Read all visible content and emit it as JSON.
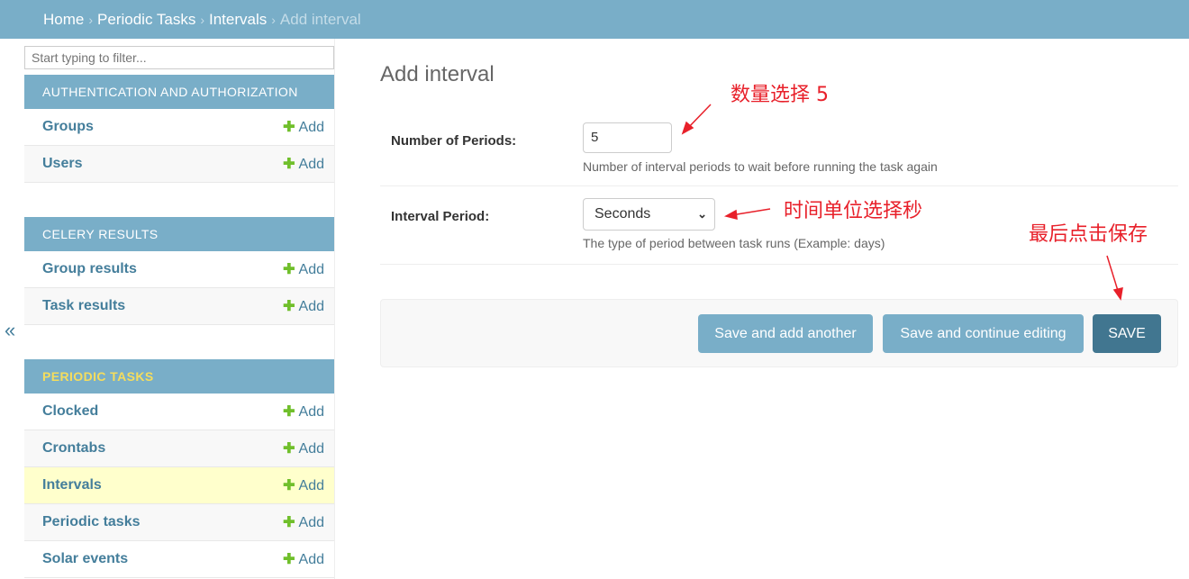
{
  "breadcrumb": {
    "items": [
      "Home",
      "Periodic Tasks",
      "Intervals"
    ],
    "current": "Add interval",
    "separator": "›"
  },
  "sidebar": {
    "filter_placeholder": "Start typing to filter...",
    "collapse": "«",
    "add_label": "Add",
    "sections": [
      {
        "title": "AUTHENTICATION AND AUTHORIZATION",
        "items": [
          "Groups",
          "Users"
        ]
      },
      {
        "title": "CELERY RESULTS",
        "items": [
          "Group results",
          "Task results"
        ]
      },
      {
        "title": "PERIODIC TASKS",
        "items": [
          "Clocked",
          "Crontabs",
          "Intervals",
          "Periodic tasks",
          "Solar events"
        ]
      }
    ],
    "selected": "Intervals"
  },
  "main": {
    "title": "Add interval",
    "fields": [
      {
        "label": "Number of Periods:",
        "value": "5",
        "help": "Number of interval periods to wait before running the task again"
      },
      {
        "label": "Interval Period:",
        "value": "Seconds",
        "help": "The type of period between task runs (Example: days)"
      }
    ],
    "buttons": {
      "save_add": "Save and add another",
      "save_continue": "Save and continue editing",
      "save": "SAVE"
    }
  },
  "annotations": [
    "数量选择 5",
    "时间单位选择秒",
    "最后点击保存"
  ],
  "colors": {
    "header": "#79aec8",
    "save": "#417690",
    "annotation": "#e8202a",
    "selected_row": "#ffffcc"
  }
}
